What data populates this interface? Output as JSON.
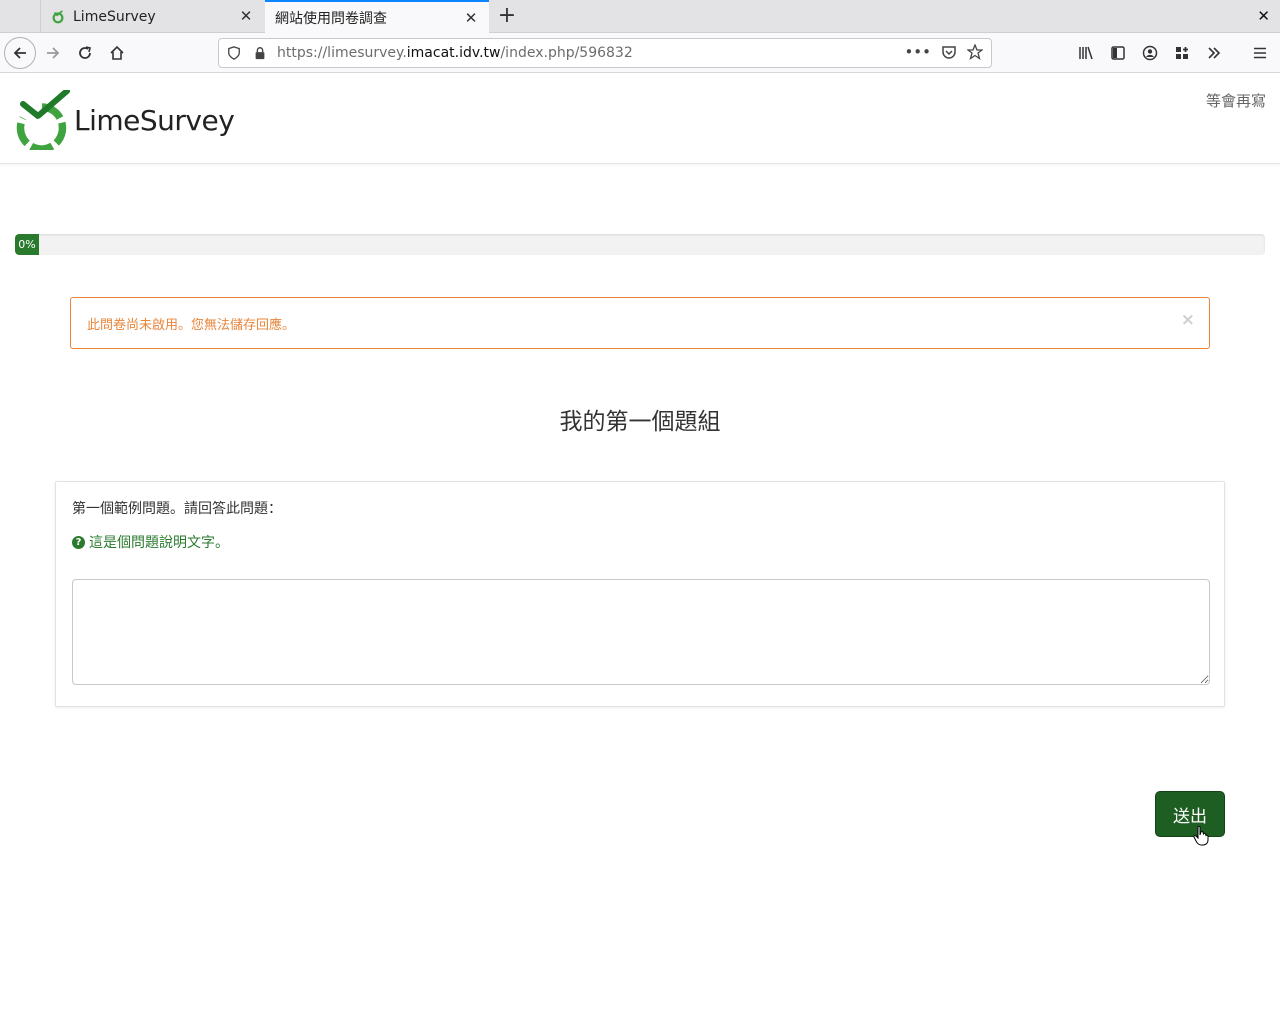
{
  "browser": {
    "tabs": [
      {
        "title": "LimeSurvey",
        "active": false
      },
      {
        "title": "網站使用問卷調查",
        "active": true
      }
    ],
    "new_tab_label": "+",
    "url": {
      "prefix": "https://limesurvey.",
      "host": "imacat.idv.tw",
      "path": "/index.php/596832"
    }
  },
  "site": {
    "logo_text": "LimeSurvey",
    "save_later": "等會再寫"
  },
  "progress": {
    "value": 0,
    "label": "0%"
  },
  "alert": {
    "message": "此問卷尚未啟用。您無法儲存回應。",
    "close": "×"
  },
  "group": {
    "title": "我的第一個題組"
  },
  "question": {
    "text": "第一個範例問題。請回答此問題：",
    "help": "這是個問題說明文字。",
    "answer_value": ""
  },
  "buttons": {
    "submit": "送出"
  },
  "colors": {
    "brand_green": "#2a7a2e",
    "submit_bg": "#1f5e23",
    "alert": "#e8853a",
    "tab_accent": "#0a84ff"
  }
}
